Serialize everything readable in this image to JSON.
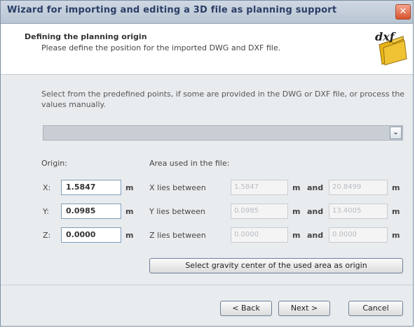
{
  "window": {
    "title": "Wizard for importing and editing a 3D file as planning support",
    "close_symbol": "✕"
  },
  "header": {
    "title": "Defining the planning origin",
    "subtitle": "Please define the position for the imported DWG and DXF file.",
    "icon": "dxf-folder-icon",
    "icon_text": "dxf"
  },
  "instructions": "Select from the predefined points, if some are provided in the DWG or DXF file, or process the values manually.",
  "predefined_combo": {
    "value": "",
    "arrow": "⌄"
  },
  "origin": {
    "label": "Origin:",
    "rows": [
      {
        "axis": "X:",
        "value": "1.5847",
        "unit": "m"
      },
      {
        "axis": "Y:",
        "value": "0.0985",
        "unit": "m"
      },
      {
        "axis": "Z:",
        "value": "0.0000",
        "unit": "m"
      }
    ]
  },
  "area": {
    "label": "Area used in the file:",
    "rows": [
      {
        "label": "X lies between",
        "min": "1.5847",
        "min_unit": "m",
        "and": "and",
        "max": "20.8499",
        "max_unit": "m"
      },
      {
        "label": "Y lies between",
        "min": "0.0985",
        "min_unit": "m",
        "and": "and",
        "max": "13.4005",
        "max_unit": "m"
      },
      {
        "label": "Z lies between",
        "min": "0.0000",
        "min_unit": "m",
        "and": "and",
        "max": "0.0000",
        "max_unit": "m"
      }
    ]
  },
  "gravity_button": "Select gravity center of the used area as origin",
  "footer": {
    "back": "< Back",
    "next": "Next >",
    "cancel": "Cancel"
  },
  "colors": {
    "title_text": "#2a3e66",
    "close_button": "#d8522d",
    "folder": "#e8b418"
  }
}
